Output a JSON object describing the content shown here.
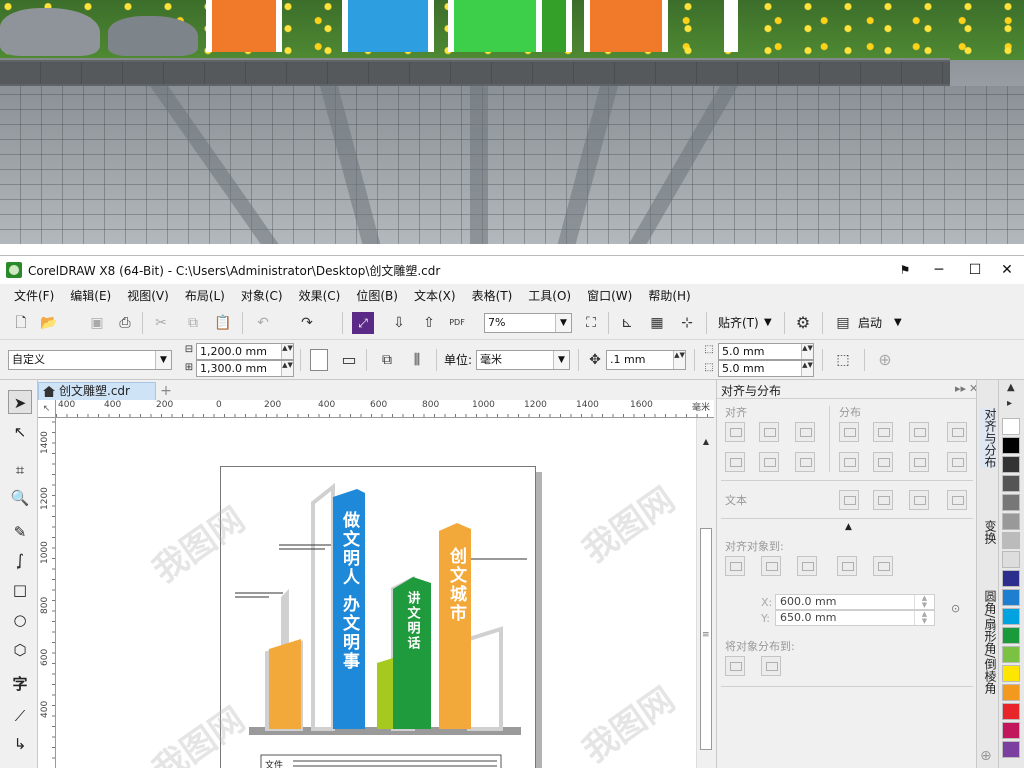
{
  "window": {
    "title": "CorelDRAW X8 (64-Bit) - C:\\Users\\Administrator\\Desktop\\创文雕塑.cdr",
    "minimize": "─",
    "maximize": "☐",
    "close": "✕"
  },
  "menu": [
    "文件(F)",
    "编辑(E)",
    "视图(V)",
    "布局(L)",
    "对象(C)",
    "效果(C)",
    "位图(B)",
    "文本(X)",
    "表格(T)",
    "工具(O)",
    "窗口(W)",
    "帮助(H)"
  ],
  "toolbar": {
    "zoom_value": "7%",
    "snap_label": "贴齐(T)",
    "launch_label": "启动",
    "pdf_label": "PDF"
  },
  "propbar": {
    "page_size": "自定义",
    "width": "1,200.0 mm",
    "height": "1,300.0 mm",
    "unit_label": "单位:",
    "unit_value": "毫米",
    "nudge": ".1 mm",
    "dup_x": "5.0 mm",
    "dup_y": "5.0 mm"
  },
  "document": {
    "tab_label": "创文雕塑.cdr",
    "add_tab": "+"
  },
  "ruler": {
    "unit": "毫米",
    "h_ticks": [
      "400",
      "400",
      "200",
      "0",
      "200",
      "400",
      "600",
      "800",
      "1000",
      "1200",
      "1400",
      "1600"
    ],
    "v_ticks": [
      "1400",
      "1200",
      "1000",
      "800",
      "600",
      "400"
    ]
  },
  "artwork": {
    "sign1": "做文明人 办文明事",
    "sign2": "讲文明话",
    "sign3": "创文城市",
    "caption": "文件"
  },
  "watermark": "我图网",
  "docker": {
    "title": "对齐与分布",
    "align_label": "对齐",
    "distribute_label": "分布",
    "text_label": "文本",
    "align_to_label": "对齐对象到:",
    "x_label": "X:",
    "x_value": "600.0 mm",
    "y_label": "Y:",
    "y_value": "650.0 mm",
    "distribute_to_label": "将对象分布到:"
  },
  "sidetabs": [
    "对齐与分布",
    "变换",
    "圆角/扇形角/倒棱角"
  ],
  "palette": {
    "colors": [
      "#ffffff",
      "#000000",
      "#333333",
      "#555555",
      "#777777",
      "#999999",
      "#bbbbbb",
      "#dddddd",
      "#2b2e8c",
      "#1e7fd0",
      "#00a3e0",
      "#1a9a3a",
      "#7cc242",
      "#ffe600",
      "#f39a1e",
      "#e8262a",
      "#c2185b",
      "#7b3fa0"
    ]
  }
}
